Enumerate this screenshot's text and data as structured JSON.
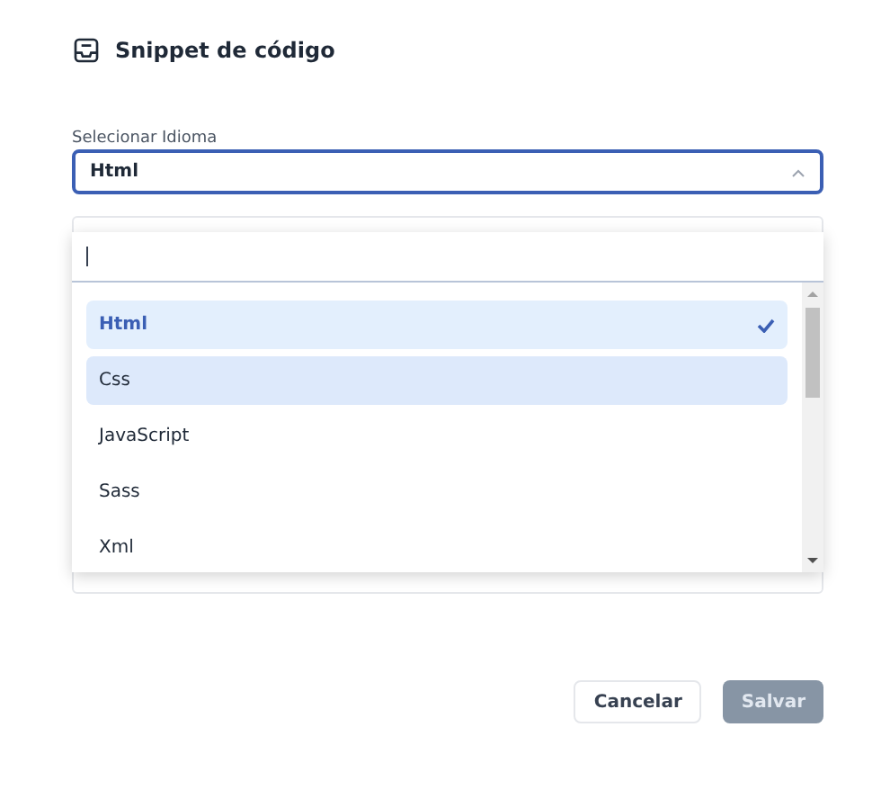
{
  "dialog": {
    "title": "Snippet de código"
  },
  "language_select": {
    "label": "Selecionar Idioma",
    "value": "Html",
    "expanded": true
  },
  "dropdown": {
    "search": {
      "focused": true
    },
    "options": [
      {
        "label": "Html",
        "selected": true,
        "hovered": false
      },
      {
        "label": "Css",
        "selected": false,
        "hovered": true
      },
      {
        "label": "JavaScript",
        "selected": false,
        "hovered": false
      },
      {
        "label": "Sass",
        "selected": false,
        "hovered": false
      },
      {
        "label": "Xml",
        "selected": false,
        "hovered": false
      }
    ]
  },
  "buttons": [
    {
      "label": "Cancelar",
      "disabled": false
    },
    {
      "label": "Salvar",
      "disabled": true
    }
  ]
}
